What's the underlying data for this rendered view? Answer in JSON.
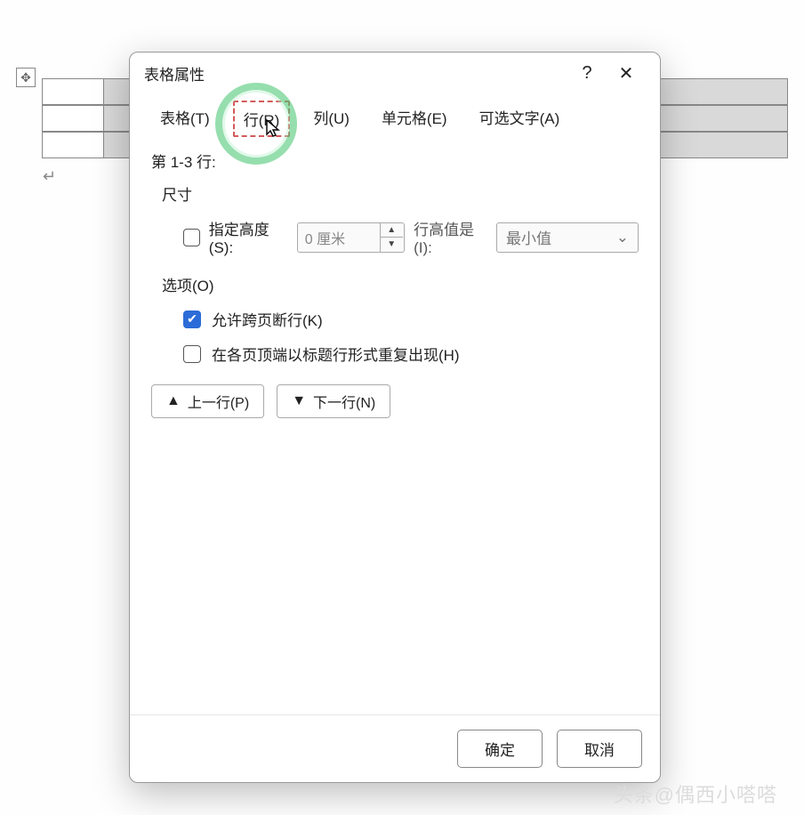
{
  "dialog": {
    "title": "表格属性",
    "help_symbol": "?",
    "close_symbol": "✕"
  },
  "tabs": {
    "table": "表格(T)",
    "row": "行(R)",
    "column": "列(U)",
    "cell": "单元格(E)",
    "alttext": "可选文字(A)"
  },
  "row_section": {
    "range_label": "第 1-3 行:",
    "size_title": "尺寸",
    "specify_height_label": "指定高度(S):",
    "height_value": "0 厘米",
    "height_mode_label": "行高值是(I):",
    "height_mode_value": "最小值",
    "options_title": "选项(O)",
    "allow_break_label": "允许跨页断行(K)",
    "repeat_header_label": "在各页顶端以标题行形式重复出现(H)"
  },
  "nav": {
    "prev": "上一行(P)",
    "next": "下一行(N)"
  },
  "footer": {
    "ok": "确定",
    "cancel": "取消"
  },
  "watermark": "头条@偶西小嗒嗒"
}
